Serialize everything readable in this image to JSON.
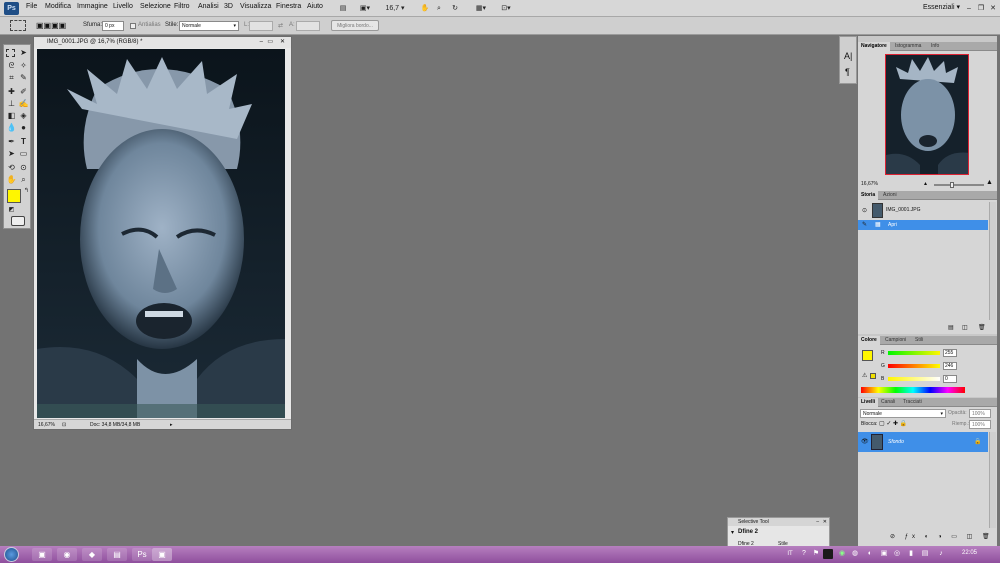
{
  "app": {
    "logo": "Ps"
  },
  "menu": [
    "File",
    "Modifica",
    "Immagine",
    "Livello",
    "Selezione",
    "Filtro",
    "Analisi",
    "3D",
    "Visualizza",
    "Finestra",
    "Aiuto"
  ],
  "toolbar": {
    "zoom_value": "16,7",
    "workspace": "Essenziali"
  },
  "options": {
    "sfuma_label": "Sfuma:",
    "sfuma_value": "0 px",
    "antialias_label": "Antialias",
    "stile_label": "Stile:",
    "stile_value": "Normale",
    "w_label": "L:",
    "h_label": "A:",
    "refine_label": "Migliora bordo..."
  },
  "document": {
    "title": "IMG_0001.JPG @ 16,7% (RGB/8) *",
    "zoom": "16,67%",
    "doc_info": "Doc: 34,8 MB/34,8 MB"
  },
  "navigator": {
    "tabs": [
      "Navigatore",
      "Istogramma",
      "Info"
    ],
    "zoom": "16,67%"
  },
  "history": {
    "tabs": [
      "Storia",
      "Azioni"
    ],
    "snapshot": "IMG_0001.JPG",
    "states": [
      "Apri"
    ]
  },
  "color": {
    "tabs": [
      "Colore",
      "Campioni",
      "Stili"
    ],
    "channels": [
      {
        "label": "R",
        "value": "255"
      },
      {
        "label": "G",
        "value": "246"
      },
      {
        "label": "B",
        "value": "0"
      }
    ],
    "foreground": "#fff600",
    "background": "#ffffff"
  },
  "layers": {
    "tabs": [
      "Livelli",
      "Canali",
      "Tracciati"
    ],
    "blend_mode": "Normale",
    "opacity_label": "Opacità:",
    "opacity_value": "100%",
    "lock_label": "Blocca:",
    "fill_label": "Riemp.:",
    "fill_value": "100%",
    "items": [
      {
        "name": "Sfondo"
      }
    ]
  },
  "selective": {
    "title": "Selective Tool",
    "row1": "Dfine 2",
    "row2a": "Dfine 2",
    "row2b": "Stile"
  },
  "taskbar": {
    "lang": "IT",
    "time": "22:05"
  },
  "colors": {
    "accent": "#3f8fe8",
    "ps_blue": "#1f4e86",
    "taskbar": "#9a5aa8"
  }
}
